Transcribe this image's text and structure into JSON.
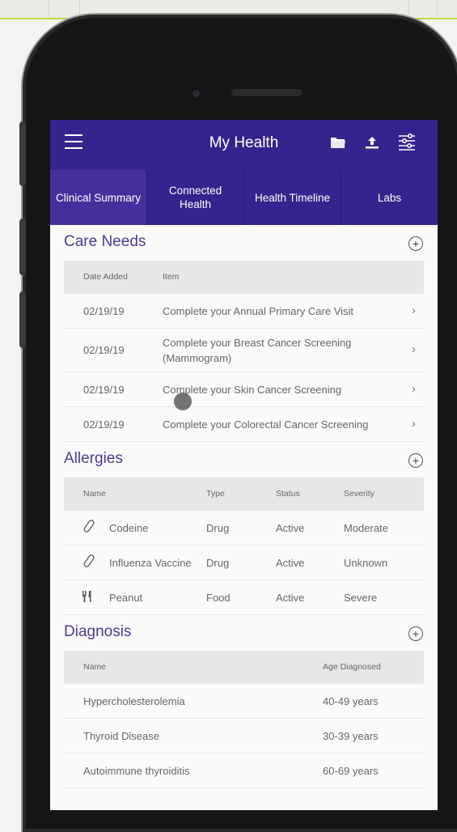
{
  "app": {
    "title": "My Health"
  },
  "tabs": [
    {
      "label": "Clinical Summary"
    },
    {
      "label": "Connected Health"
    },
    {
      "label": "Health Timeline"
    },
    {
      "label": "Labs"
    }
  ],
  "care_needs": {
    "title": "Care Needs",
    "headers": {
      "date": "Date Added",
      "item": "Item"
    },
    "rows": [
      {
        "date": "02/19/19",
        "item": "Complete your Annual Primary Care Visit"
      },
      {
        "date": "02/19/19",
        "item": "Complete your Breast Cancer Screening (Mammogram)"
      },
      {
        "date": "02/19/19",
        "item": "Complete your Skin Cancer Screening"
      },
      {
        "date": "02/19/19",
        "item": "Complete your Colorectal Cancer Screening"
      }
    ]
  },
  "allergies": {
    "title": "Allergies",
    "headers": {
      "name": "Name",
      "type": "Type",
      "status": "Status",
      "severity": "Severity"
    },
    "rows": [
      {
        "icon": "pill-icon",
        "name": "Codeine",
        "type": "Drug",
        "status": "Active",
        "severity": "Moderate"
      },
      {
        "icon": "pill-icon",
        "name": "Influenza Vaccine",
        "type": "Drug",
        "status": "Active",
        "severity": "Unknown"
      },
      {
        "icon": "fork-knife-icon",
        "name": "Peanut",
        "type": "Food",
        "status": "Active",
        "severity": "Severe"
      }
    ]
  },
  "diagnosis": {
    "title": "Diagnosis",
    "headers": {
      "name": "Name",
      "age": "Age Diagnosed"
    },
    "rows": [
      {
        "name": "Hypercholesterolemia",
        "age": "40-49 years"
      },
      {
        "name": "Thyroid Disease",
        "age": "30-39 years"
      },
      {
        "name": "Autoimmune thyroiditis",
        "age": "60-69 years"
      }
    ]
  },
  "colors": {
    "primary": "#35248d",
    "accent": "#4b3d92",
    "header_bg": "#e7e7e7"
  }
}
